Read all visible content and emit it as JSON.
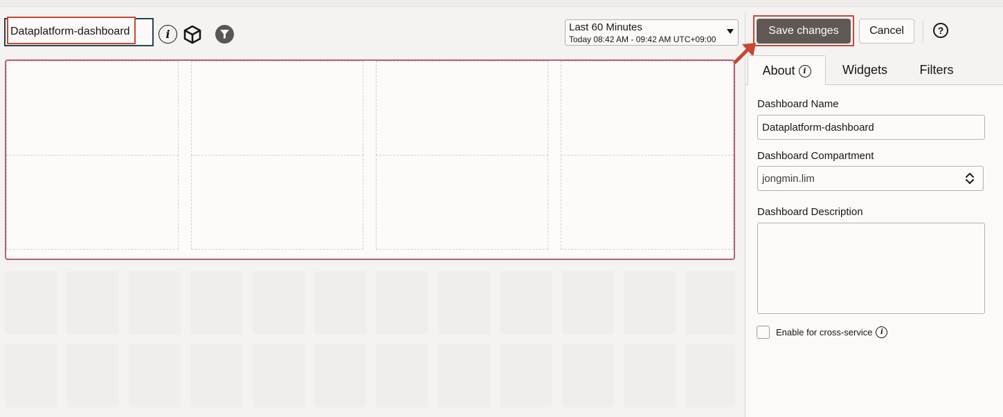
{
  "header": {
    "dashboard_title": "Dataplatform-dashboard",
    "info_glyph": "i",
    "icons": [
      "info-icon",
      "cube-icon",
      "filter-icon"
    ]
  },
  "time_range": {
    "label": "Last 60 Minutes",
    "detail": "Today 08:42 AM - 09:42 AM UTC+09:00"
  },
  "toolbar": {
    "save_label": "Save changes",
    "cancel_label": "Cancel",
    "help_glyph": "?"
  },
  "tabs": [
    {
      "label": "About",
      "selected": true
    },
    {
      "label": "Widgets",
      "selected": false
    },
    {
      "label": "Filters",
      "selected": false
    }
  ],
  "form": {
    "name_label": "Dashboard Name",
    "name_value": "Dataplatform-dashboard",
    "compartment_label": "Dashboard Compartment",
    "compartment_value": "jongmin.lim",
    "description_label": "Dashboard Description",
    "description_value": "",
    "cross_service_label": "Enable for cross-service",
    "cross_service_checked": false
  },
  "colors": {
    "highlight": "#c74634",
    "save_button": "#5f5854",
    "canvas_border": "#b55f73",
    "title_frame": "#24424f"
  }
}
